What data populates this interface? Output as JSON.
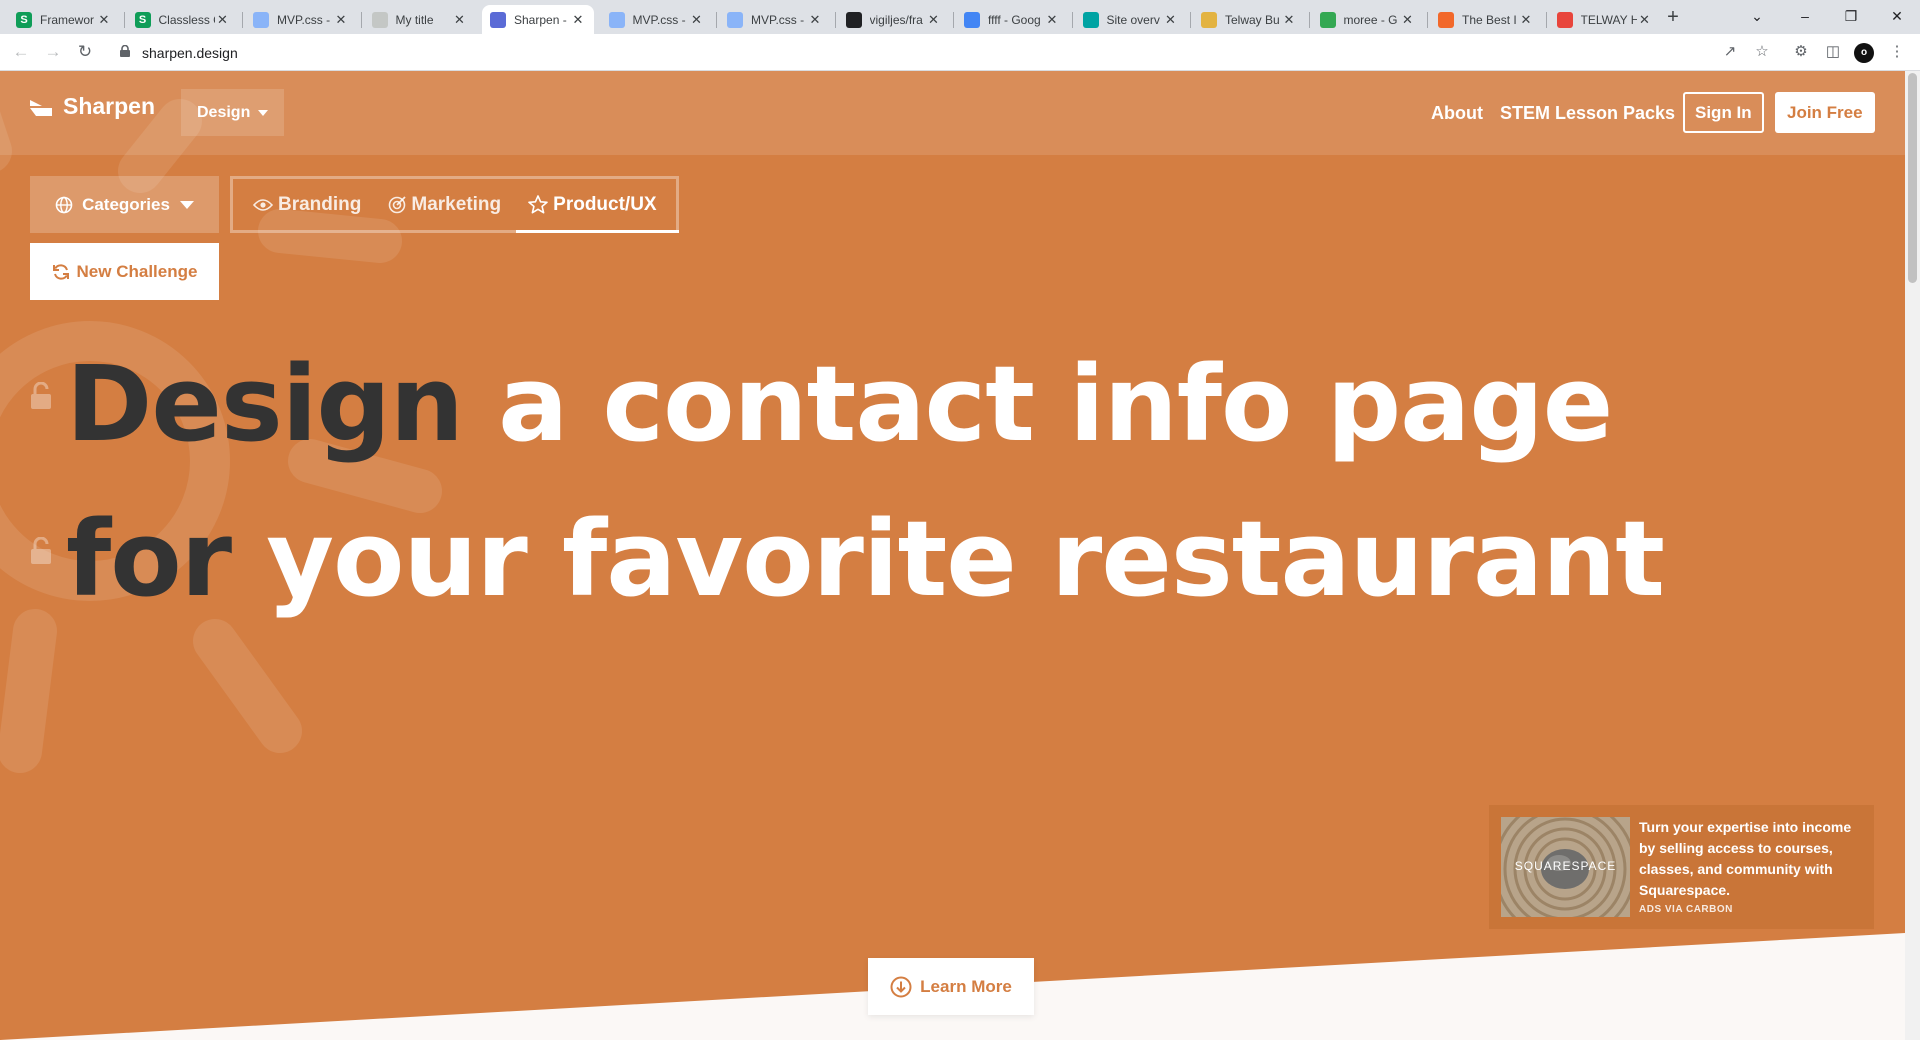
{
  "browser": {
    "tabs": [
      {
        "title": "Framewor",
        "favicon_letter": "S",
        "favicon_color": "#0f9d58"
      },
      {
        "title": "Classless C",
        "favicon_letter": "S",
        "favicon_color": "#0f9d58"
      },
      {
        "title": "MVP.css -",
        "favicon_letter": "",
        "favicon_color": "#8ab4f8"
      },
      {
        "title": "My title",
        "favicon_letter": "",
        "favicon_color": "#c4c7c5"
      },
      {
        "title": "Sharpen -",
        "favicon_letter": "",
        "favicon_color": "#5b6bd6",
        "active": true
      },
      {
        "title": "MVP.css -",
        "favicon_letter": "",
        "favicon_color": "#8ab4f8"
      },
      {
        "title": "MVP.css -",
        "favicon_letter": "",
        "favicon_color": "#8ab4f8"
      },
      {
        "title": "vigiljes/fra",
        "favicon_letter": "",
        "favicon_color": "#202124"
      },
      {
        "title": "ffff - Goog",
        "favicon_letter": "",
        "favicon_color": "#4285f4"
      },
      {
        "title": "Site overv",
        "favicon_letter": "",
        "favicon_color": "#00a3a3"
      },
      {
        "title": "Telway Bu",
        "favicon_letter": "",
        "favicon_color": "#e3b341"
      },
      {
        "title": "moree - G",
        "favicon_letter": "",
        "favicon_color": "#34a853"
      },
      {
        "title": "The Best I",
        "favicon_letter": "",
        "favicon_color": "#f2682a"
      },
      {
        "title": "TELWAY H",
        "favicon_letter": "",
        "favicon_color": "#e8453c"
      }
    ],
    "url": "sharpen.design",
    "profile_initial": "o"
  },
  "header": {
    "logo_text": "Sharpen",
    "design_dropdown": "Design",
    "nav_about": "About",
    "nav_stem": "STEM Lesson Packs",
    "sign_in": "Sign In",
    "join_free": "Join Free"
  },
  "controls": {
    "categories_label": "Categories",
    "tabs": [
      {
        "label": "Branding",
        "icon": "eye-icon"
      },
      {
        "label": "Marketing",
        "icon": "target-icon"
      },
      {
        "label": "Product/UX",
        "icon": "star-icon",
        "active": true
      }
    ],
    "new_challenge": "New Challenge"
  },
  "challenge": {
    "line1_verb": "Design",
    "line1_rest": "a contact info page",
    "line2_prep": "for",
    "line2_rest": "your favorite restaurant"
  },
  "ad": {
    "brand": "SQUARESPACE",
    "text": "Turn your expertise into income by selling access to courses, classes, and community with Squarespace.",
    "via": "ADS VIA CARBON"
  },
  "learn_more": "Learn More",
  "colors": {
    "accent": "#d47e42",
    "dark_text": "#333333"
  }
}
